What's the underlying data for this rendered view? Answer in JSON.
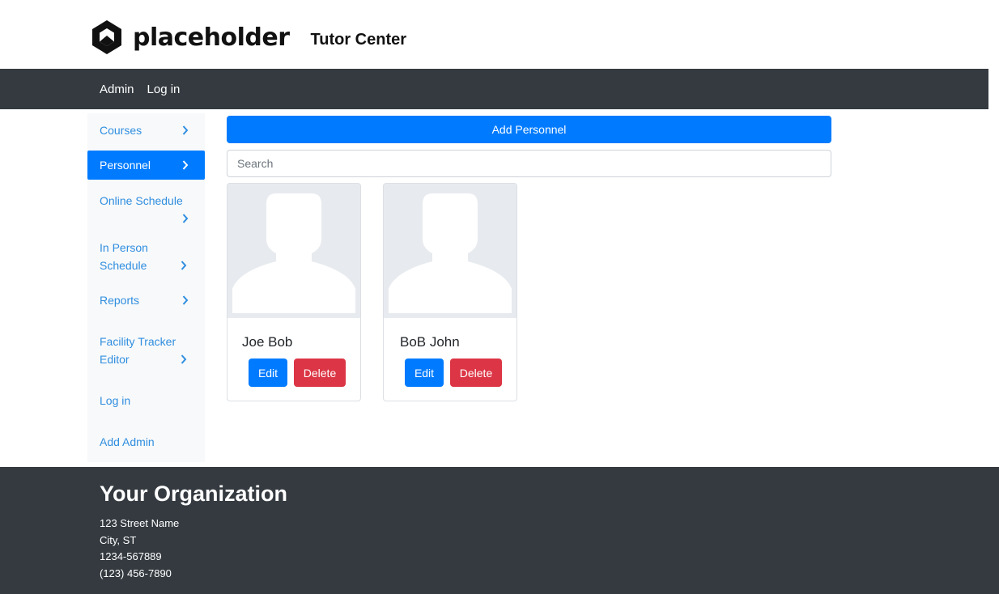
{
  "brand": {
    "logo_text": "placeholder",
    "title": "Tutor Center"
  },
  "navbar": {
    "items": [
      "Admin",
      "Log in"
    ]
  },
  "sidebar": {
    "items": [
      {
        "label": "Courses",
        "active": false
      },
      {
        "label": "Personnel",
        "active": true
      },
      {
        "label": "Online Schedule",
        "active": false
      },
      {
        "label": "In Person Schedule",
        "active": false
      },
      {
        "label": "Reports",
        "active": false
      },
      {
        "label": "Facility Tracker Editor",
        "active": false
      },
      {
        "label": "Log in",
        "active": false
      },
      {
        "label": "Add Admin",
        "active": false
      }
    ]
  },
  "main": {
    "add_button": "Add Personnel",
    "search_placeholder": "Search",
    "cards": [
      {
        "name": "Joe Bob",
        "edit": "Edit",
        "delete": "Delete"
      },
      {
        "name": "BoB John",
        "edit": "Edit",
        "delete": "Delete"
      }
    ]
  },
  "footer": {
    "org": "Your Organization",
    "lines": [
      "123 Street Name",
      "City, ST",
      "1234-567889",
      "(123) 456-7890"
    ]
  },
  "colors": {
    "primary": "#007bff",
    "danger": "#dc3545",
    "dark": "#343a40",
    "link": "#2f8ee0"
  }
}
